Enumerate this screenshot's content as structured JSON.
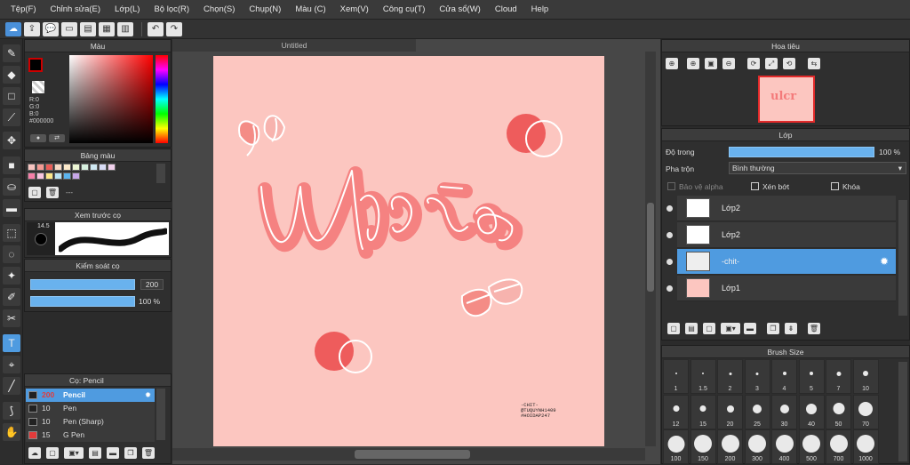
{
  "menu": [
    "Tệp(F)",
    "Chỉnh sửa(E)",
    "Lớp(L)",
    "Bộ lọc(R)",
    "Chọn(S)",
    "Chụp(N)",
    "Màu (C)",
    "Xem(V)",
    "Công cụ(T)",
    "Cửa sổ(W)",
    "Cloud",
    "Help"
  ],
  "color_panel": {
    "title": "Màu",
    "rgb_r": "R:0",
    "rgb_g": "G:0",
    "rgb_b": "B:0",
    "hex": "#000000",
    "fg_color": "#000000",
    "bg_color": "#ffffff",
    "hue_color": "#ff0000"
  },
  "palette_panel": {
    "title": "Bảng màu",
    "swatches": [
      "#f7c4c0",
      "#f39a93",
      "#ea5c56",
      "#f7d9c4",
      "#fbe8c9",
      "#ecf6d4",
      "#d7f0df",
      "#cfe9f3",
      "#d7dbf5",
      "#f0d0ec",
      "#f57fa8",
      "#f8c6e0",
      "#fde88a",
      "#b9e3f6",
      "#5bb4ef",
      "#c7a7e9"
    ],
    "dash": "---"
  },
  "brush_preview_panel": {
    "title": "Xem trước cọ",
    "size_label": "14.5"
  },
  "brush_control_panel": {
    "title": "Kiểm soát cọ",
    "size_value": "200",
    "opacity_value": "100 %",
    "size_fraction": 1.0,
    "opacity_fraction": 1.0
  },
  "brush_list_panel": {
    "title": "Cọ: Pencil",
    "rows": [
      {
        "size": "200",
        "name": "Pencil",
        "color": "#222222"
      },
      {
        "size": "10",
        "name": "Pen",
        "color": "#222222"
      },
      {
        "size": "10",
        "name": "Pen (Sharp)",
        "color": "#222222"
      },
      {
        "size": "15",
        "name": "G Pen",
        "color": "#e23b3b"
      }
    ]
  },
  "document": {
    "tab_title": "Untitled",
    "canvas_bg": "#fcc6c0",
    "signature": [
      "-CHIT-",
      "@TUQUYNH1409",
      "#HOIDAP247"
    ]
  },
  "navigator_panel": {
    "title": "Hoa tiêu"
  },
  "layer_panel": {
    "title": "Lớp",
    "opacity_label": "Độ trong",
    "opacity_value": "100 %",
    "opacity_fraction": 1.0,
    "blend_label": "Pha trộn",
    "blend_value": "Bình thường",
    "protect_alpha": "Bảo vệ alpha",
    "clipping": "Xén bớt",
    "lock": "Khóa",
    "layers": [
      {
        "name": "Lớp2",
        "selected": false
      },
      {
        "name": "Lớp2",
        "selected": false
      },
      {
        "name": "-chit-",
        "selected": true
      },
      {
        "name": "Lớp1",
        "selected": false
      }
    ]
  },
  "brush_size_panel": {
    "title": "Brush Size",
    "sizes": [
      "1",
      "1.5",
      "2",
      "3",
      "4",
      "5",
      "7",
      "10",
      "12",
      "15",
      "20",
      "25",
      "30",
      "40",
      "50",
      "70",
      "100",
      "150",
      "200",
      "300",
      "400",
      "500",
      "700",
      "1000"
    ]
  }
}
